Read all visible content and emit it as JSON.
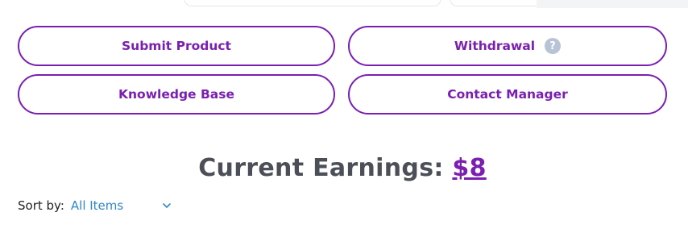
{
  "buttons": {
    "submit_product": "Submit Product",
    "withdrawal": "Withdrawal",
    "withdrawal_help": "?",
    "knowledge_base": "Knowledge Base",
    "contact_manager": "Contact Manager"
  },
  "earnings": {
    "label": "Current Earnings:",
    "amount": "$8"
  },
  "sort": {
    "label": "Sort by:",
    "selected": "All Items"
  },
  "colors": {
    "accent": "#7b1fb1",
    "link": "#2f88c9",
    "help_icon": "#b7c4d6"
  }
}
